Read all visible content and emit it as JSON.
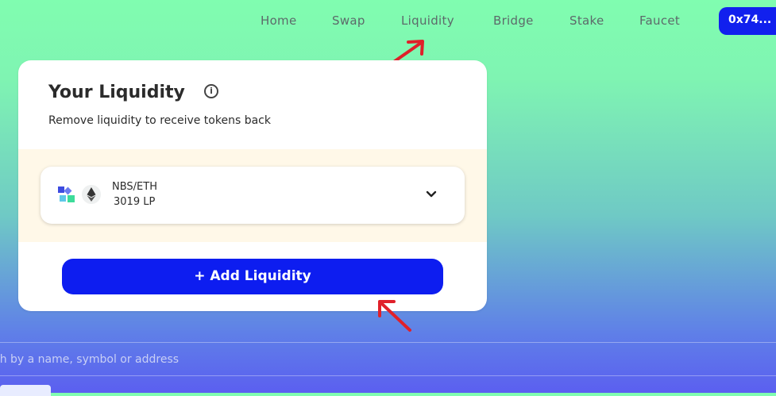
{
  "nav": {
    "items": [
      {
        "label": "Home"
      },
      {
        "label": "Swap"
      },
      {
        "label": "Liquidity"
      },
      {
        "label": "Bridge"
      },
      {
        "label": "Stake"
      },
      {
        "label": "Faucet"
      }
    ],
    "wallet_label": "0x74..."
  },
  "card": {
    "title": "Your Liquidity",
    "info_glyph": "i",
    "subtitle": "Remove liquidity to receive tokens back",
    "position": {
      "pair": "NBS/ETH",
      "amount": "3019 LP"
    },
    "add_button_label": "+ Add Liquidity"
  },
  "search": {
    "placeholder": "ch by a name, symbol or address"
  },
  "icons": {
    "info": "info-icon",
    "chevron": "chevron-down-icon",
    "token_a": "nbs-token-icon",
    "token_b": "eth-token-icon",
    "annotation": "red-arrow"
  },
  "colors": {
    "accent": "#0d1df0",
    "annotation": "#e0202a"
  }
}
